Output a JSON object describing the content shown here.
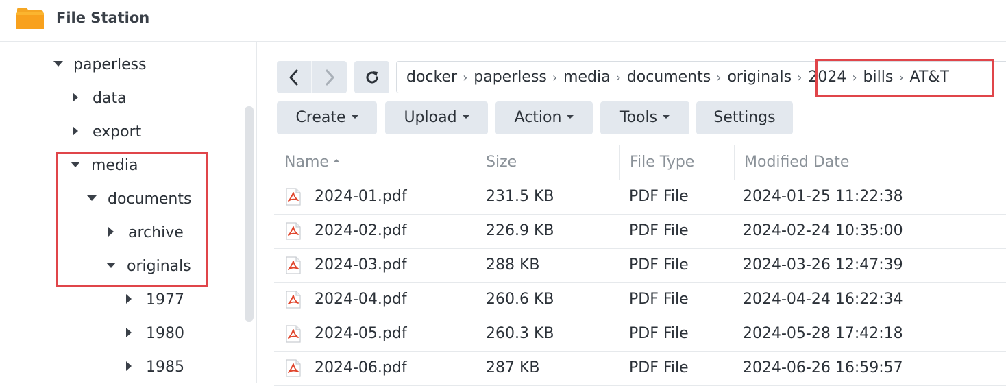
{
  "app": {
    "title": "File Station",
    "icon": "folder-icon"
  },
  "sidebar": {
    "items": [
      {
        "label": "paperless",
        "expanded": true
      },
      {
        "label": "data",
        "expanded": false
      },
      {
        "label": "export",
        "expanded": false
      },
      {
        "label": "media",
        "expanded": true
      },
      {
        "label": "documents",
        "expanded": true
      },
      {
        "label": "archive",
        "expanded": false
      },
      {
        "label": "originals",
        "expanded": true
      },
      {
        "label": "1977",
        "expanded": false
      },
      {
        "label": "1980",
        "expanded": false
      },
      {
        "label": "1985",
        "expanded": false
      }
    ]
  },
  "navigation": {
    "back_icon": "chevron-left-icon",
    "forward_icon": "chevron-right-icon",
    "refresh_icon": "refresh-icon"
  },
  "breadcrumb": [
    "docker",
    "paperless",
    "media",
    "documents",
    "originals",
    "2024",
    "bills",
    "AT&T"
  ],
  "toolbar": {
    "create": "Create",
    "upload": "Upload",
    "action": "Action",
    "tools": "Tools",
    "settings": "Settings"
  },
  "table": {
    "columns": [
      "Name",
      "Size",
      "File Type",
      "Modified Date"
    ],
    "sort": {
      "column": "Name",
      "direction": "asc"
    },
    "rows": [
      {
        "name": "2024-01.pdf",
        "size": "231.5 KB",
        "type": "PDF File",
        "modified": "2024-01-25 11:22:38"
      },
      {
        "name": "2024-02.pdf",
        "size": "226.9 KB",
        "type": "PDF File",
        "modified": "2024-02-24 10:35:00"
      },
      {
        "name": "2024-03.pdf",
        "size": "288 KB",
        "type": "PDF File",
        "modified": "2024-03-26 12:47:39"
      },
      {
        "name": "2024-04.pdf",
        "size": "260.6 KB",
        "type": "PDF File",
        "modified": "2024-04-24 16:22:34"
      },
      {
        "name": "2024-05.pdf",
        "size": "260.3 KB",
        "type": "PDF File",
        "modified": "2024-05-28 17:42:18"
      },
      {
        "name": "2024-06.pdf",
        "size": "287 KB",
        "type": "PDF File",
        "modified": "2024-06-26 16:59:57"
      }
    ]
  },
  "colors": {
    "highlight": "#e0454a",
    "button_bg": "#e3e8ee",
    "pdf_red": "#e0452c"
  }
}
